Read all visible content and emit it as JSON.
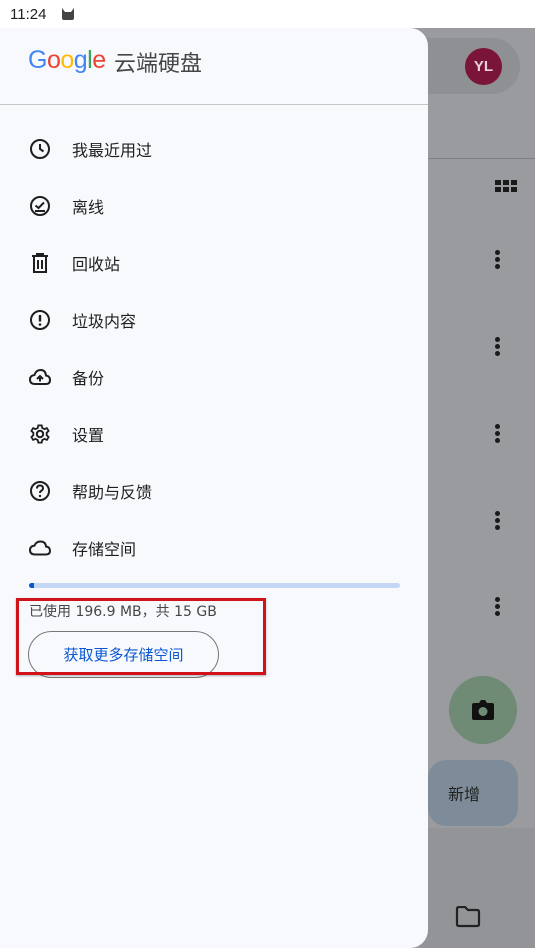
{
  "status_bar": {
    "time": "11:24"
  },
  "background": {
    "avatar_initials": "YL",
    "new_label": "新增",
    "files_label": "文件"
  },
  "drawer": {
    "logo": {
      "G": "G",
      "o1": "o",
      "o2": "o",
      "g": "g",
      "l": "l",
      "e": "e"
    },
    "title": "云端硬盘",
    "items": [
      {
        "label": "我最近用过",
        "icon": "clock-icon"
      },
      {
        "label": "离线",
        "icon": "offline-check-icon"
      },
      {
        "label": "回收站",
        "icon": "trash-icon"
      },
      {
        "label": "垃圾内容",
        "icon": "spam-alert-icon"
      },
      {
        "label": "备份",
        "icon": "cloud-upload-icon"
      },
      {
        "label": "设置",
        "icon": "gear-icon"
      },
      {
        "label": "帮助与反馈",
        "icon": "help-icon"
      },
      {
        "label": "存储空间",
        "icon": "cloud-icon"
      }
    ],
    "storage": {
      "used_fraction": 0.013,
      "text": "已使用 196.9 MB，共 15 GB",
      "button_label": "获取更多存储空间"
    }
  },
  "colors": {
    "accent": "#0b57d0",
    "highlight": "#d0131b"
  }
}
